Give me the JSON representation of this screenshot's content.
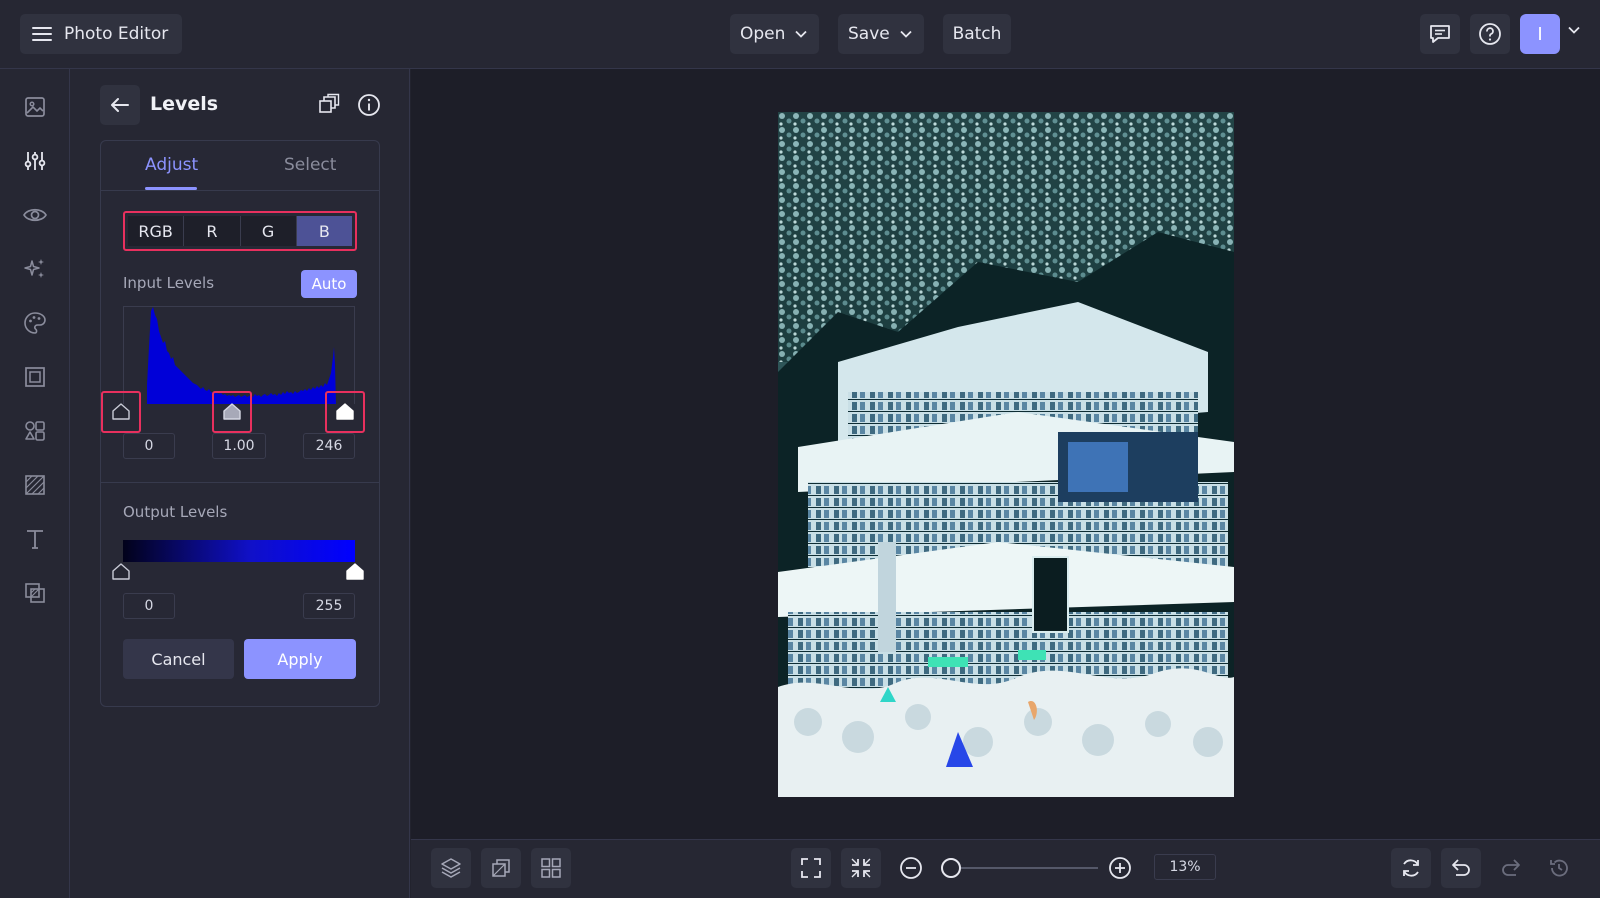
{
  "app": {
    "title": "Photo Editor"
  },
  "toolbar": {
    "open_label": "Open",
    "save_label": "Save",
    "batch_label": "Batch",
    "avatar_initial": "I"
  },
  "rail": {
    "items": [
      {
        "icon": "image-icon"
      },
      {
        "icon": "sliders-icon"
      },
      {
        "icon": "eye-icon"
      },
      {
        "icon": "sparkle-icon"
      },
      {
        "icon": "palette-icon"
      },
      {
        "icon": "frame-icon"
      },
      {
        "icon": "shapes-icon"
      },
      {
        "icon": "texture-icon"
      },
      {
        "icon": "text-icon"
      },
      {
        "icon": "overlay-icon"
      }
    ],
    "active_index": 1
  },
  "panel": {
    "title": "Levels",
    "tabs": [
      {
        "label": "Adjust"
      },
      {
        "label": "Select"
      }
    ],
    "active_tab": "Adjust",
    "channels": [
      {
        "label": "RGB"
      },
      {
        "label": "R"
      },
      {
        "label": "G"
      },
      {
        "label": "B"
      }
    ],
    "active_channel": "B",
    "input_levels": {
      "label": "Input Levels",
      "auto_label": "Auto",
      "black": "0",
      "gamma": "1.00",
      "white": "246"
    },
    "output_levels": {
      "label": "Output Levels",
      "black": "0",
      "white": "255"
    },
    "cancel_label": "Cancel",
    "apply_label": "Apply"
  },
  "zoom": {
    "value": "13%",
    "level": 0.13
  },
  "colors": {
    "accent": "#8c93ff",
    "highlight": "#e8305e",
    "histogram": "#0000d8"
  }
}
